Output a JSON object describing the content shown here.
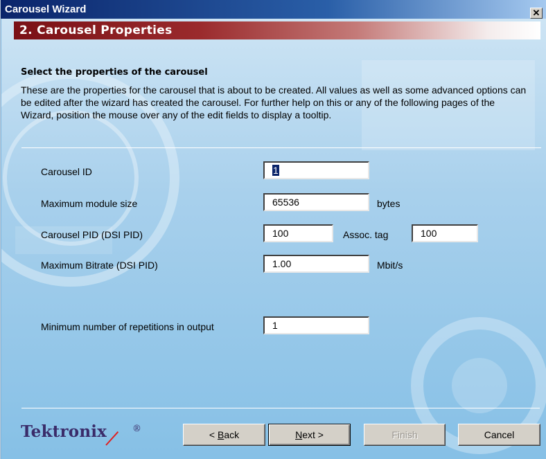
{
  "window": {
    "title": "Carousel Wizard",
    "close_label": "✕"
  },
  "header": {
    "step_title": "2. Carousel Properties"
  },
  "intro": {
    "subtitle": "Select the properties of the carousel",
    "description": "These are the properties for the carousel that is about to be created. All values as well as some advanced options can be edited after the wizard has created the carousel. For further help on this or any of the following pages of the Wizard, position the mouse over any of the edit fields to display a tooltip."
  },
  "form": {
    "carousel_id": {
      "label": "Carousel ID",
      "value": "1"
    },
    "max_module_size": {
      "label": "Maximum module size",
      "value": "65536",
      "unit": "bytes"
    },
    "carousel_pid": {
      "label": "Carousel PID (DSI PID)",
      "value": "100"
    },
    "assoc_tag": {
      "label": "Assoc. tag",
      "value": "100"
    },
    "max_bitrate": {
      "label": "Maximum Bitrate (DSI PID)",
      "value": "1.00",
      "unit": "Mbit/s"
    },
    "min_repetitions": {
      "label": "Minimum number of repetitions in output",
      "value": "1"
    }
  },
  "footer": {
    "logo_text": "Tektronix",
    "logo_mark": "®",
    "back_pre": "< ",
    "back_key": "B",
    "back_post": "ack",
    "next_key": "N",
    "next_post": "ext >",
    "finish_label": "Finish",
    "cancel_label": "Cancel"
  },
  "colors": {
    "title_bar": "#0a246a",
    "header_bar": "#7a1016",
    "logo": "#3a2c6a"
  }
}
